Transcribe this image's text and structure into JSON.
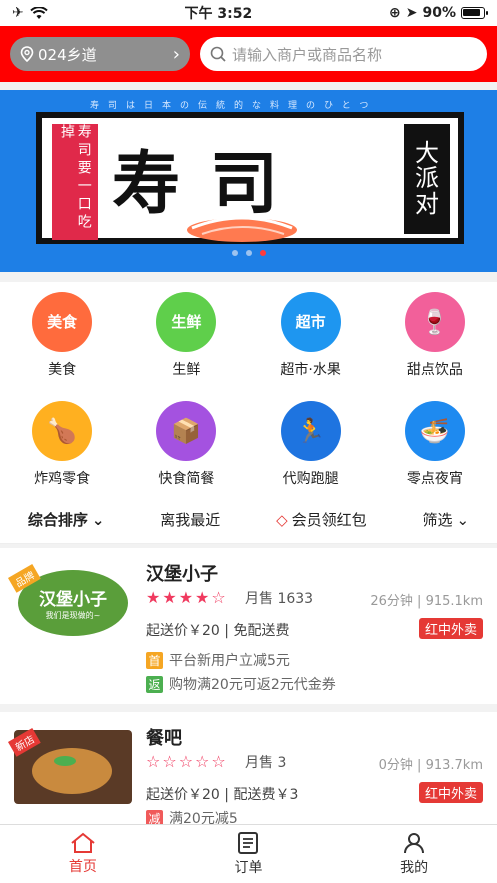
{
  "status": {
    "time": "下午 3:52",
    "battery": "90%"
  },
  "header": {
    "location": "024乡道",
    "search_placeholder": "请输入商户或商品名称"
  },
  "banner": {
    "strip_text": "寿司は日本の伝統的な料理のひとつ",
    "left_text": "寿司要一口吃掉",
    "main_text": "寿司",
    "right_text": "大派对",
    "dots": 3,
    "active_dot": 3
  },
  "categories": [
    {
      "label": "美食",
      "icon_text": "美食",
      "icon": "food-icon",
      "color": "#ff6b3d"
    },
    {
      "label": "生鲜",
      "icon_text": "生鲜",
      "icon": "produce-icon",
      "color": "#5fcf4b"
    },
    {
      "label": "超市·水果",
      "icon_text": "超市",
      "icon": "supermarket-icon",
      "color": "#1e96f0"
    },
    {
      "label": "甜点饮品",
      "icon_text": "",
      "icon": "wine-glass-icon",
      "color": "#f2609a"
    },
    {
      "label": "炸鸡零食",
      "icon_text": "",
      "icon": "chicken-leg-icon",
      "color": "#ffb020"
    },
    {
      "label": "快食简餐",
      "icon_text": "",
      "icon": "meal-box-icon",
      "color": "#a452e0"
    },
    {
      "label": "代购跑腿",
      "icon_text": "",
      "icon": "runner-icon",
      "color": "#1e74e0"
    },
    {
      "label": "零点夜宵",
      "icon_text": "",
      "icon": "noodle-bowl-icon",
      "color": "#1e8af0"
    }
  ],
  "sort": {
    "overall": "综合排序",
    "nearest": "离我最近",
    "member": "会员领红包",
    "filter": "筛选"
  },
  "shops": [
    {
      "name": "汉堡小子",
      "tag": "品牌",
      "logo_text": "汉堡小子",
      "logo_sub": "我们是现做的~",
      "rating": 4,
      "sales": "月售 1633",
      "time": "26分钟",
      "distance": "915.1km",
      "min_price": "起送价￥20",
      "delivery": "免配送费",
      "platform": "红中外卖",
      "promos": [
        {
          "badge": "首",
          "color": "#f5a623",
          "text": "平台新用户立减5元"
        },
        {
          "badge": "返",
          "color": "#4caf50",
          "text": "购物满20元可返2元代金券"
        }
      ]
    },
    {
      "name": "餐吧",
      "tag": "新店",
      "rating": 0,
      "sales": "月售 3",
      "time": "0分钟",
      "distance": "913.7km",
      "min_price": "起送价￥20",
      "delivery": "配送费￥3",
      "platform": "红中外卖",
      "promos": [
        {
          "badge": "减",
          "color": "#f05a5a",
          "text": "满20元减5"
        }
      ]
    }
  ],
  "tabs": [
    {
      "label": "首页",
      "active": true
    },
    {
      "label": "订单",
      "active": false
    },
    {
      "label": "我的",
      "active": false
    }
  ]
}
